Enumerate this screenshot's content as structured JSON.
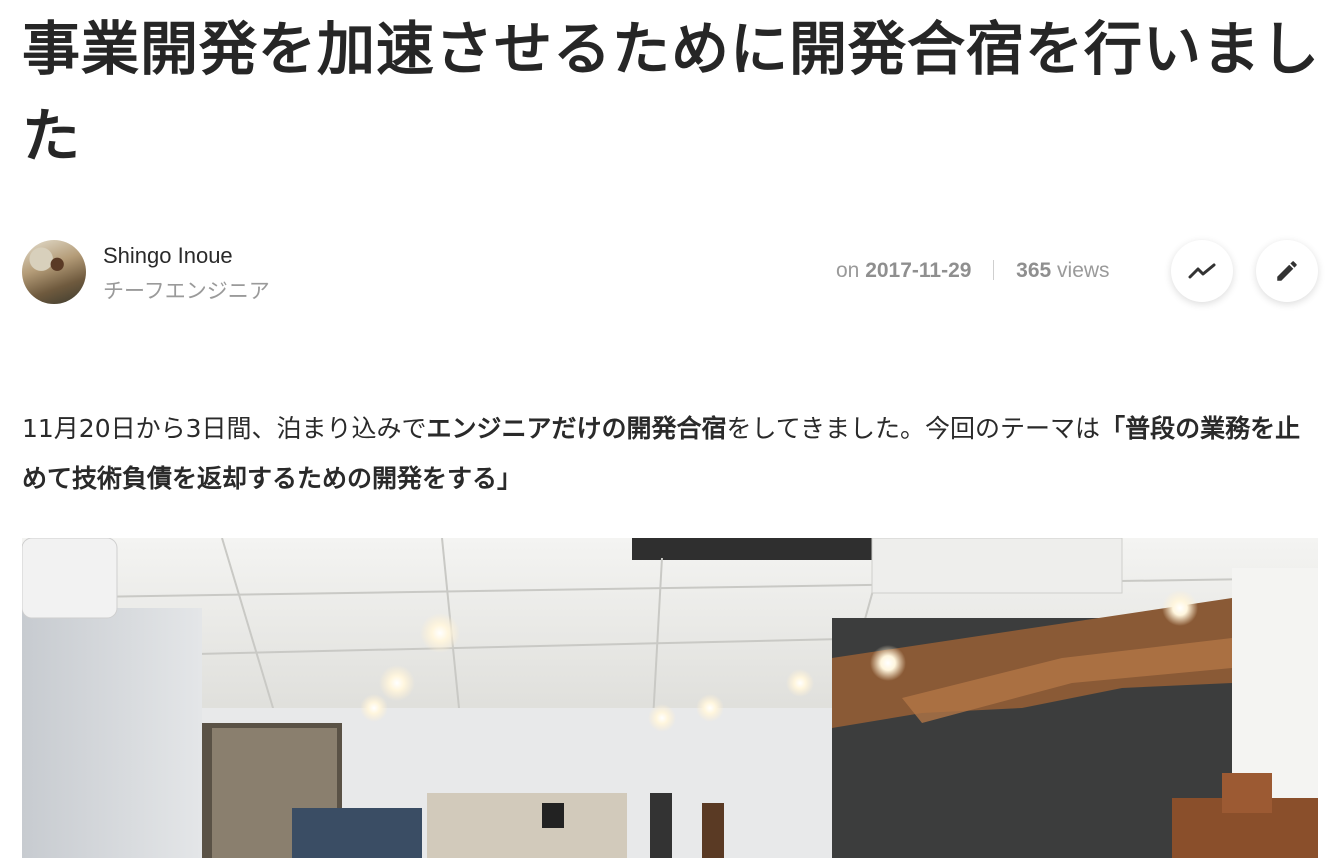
{
  "article": {
    "title": "事業開発を加速させるために開発合宿を行いました"
  },
  "author": {
    "name": "Shingo Inoue",
    "role": "チーフエンジニア"
  },
  "meta": {
    "on_label": "on",
    "date": "2017-11-29",
    "views_count": "365",
    "views_label": "views"
  },
  "actions": {
    "trend_icon": "trend-icon",
    "edit_icon": "pencil-icon"
  },
  "intro": {
    "part1": "11月20日から3日間、泊まり込みで",
    "bold1": "エンジニアだけの開発合宿",
    "part2": "をしてきました。今回のテーマは",
    "bold2": "「普段の業務を止めて技術負債を返却するための開発をする」"
  },
  "colors": {
    "title": "#262626",
    "muted": "#9a9a9a",
    "text": "#2a2a2a"
  }
}
